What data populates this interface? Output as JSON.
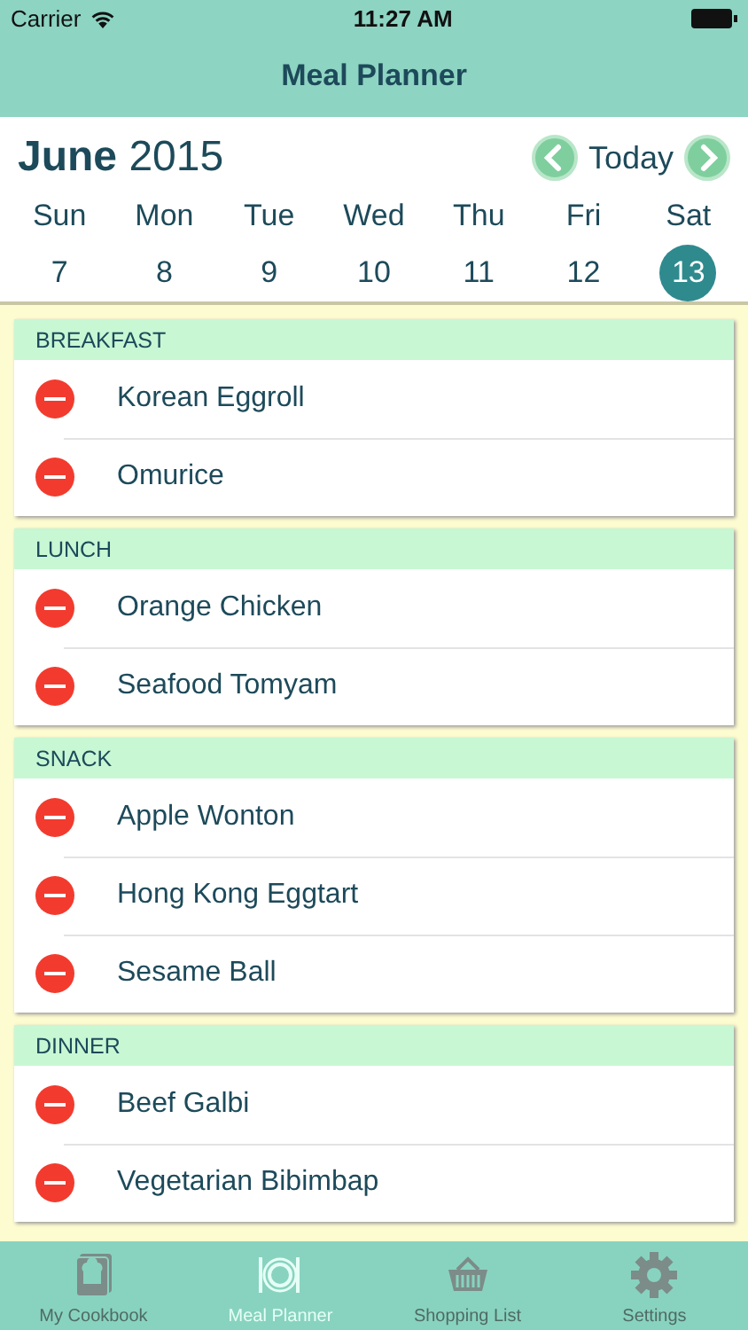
{
  "status_bar": {
    "carrier": "Carrier",
    "time": "11:27 AM"
  },
  "nav": {
    "title": "Meal Planner"
  },
  "calendar": {
    "month": "June",
    "year": "2015",
    "today_label": "Today",
    "days": [
      {
        "weekday": "Sun",
        "date": "7",
        "selected": false
      },
      {
        "weekday": "Mon",
        "date": "8",
        "selected": false
      },
      {
        "weekday": "Tue",
        "date": "9",
        "selected": false
      },
      {
        "weekday": "Wed",
        "date": "10",
        "selected": false
      },
      {
        "weekday": "Thu",
        "date": "11",
        "selected": false
      },
      {
        "weekday": "Fri",
        "date": "12",
        "selected": false
      },
      {
        "weekday": "Sat",
        "date": "13",
        "selected": true
      }
    ]
  },
  "sections": [
    {
      "title": "BREAKFAST",
      "items": [
        "Korean Eggroll",
        "Omurice"
      ]
    },
    {
      "title": "LUNCH",
      "items": [
        "Orange Chicken",
        "Seafood Tomyam"
      ]
    },
    {
      "title": "SNACK",
      "items": [
        "Apple Wonton",
        "Hong Kong Eggtart",
        "Sesame Ball"
      ]
    },
    {
      "title": "DINNER",
      "items": [
        "Beef Galbi",
        "Vegetarian Bibimbap"
      ]
    }
  ],
  "tab_bar": [
    {
      "label": "My Cookbook",
      "kind": "cookbook",
      "selected": false
    },
    {
      "label": "Meal Planner",
      "kind": "plate",
      "selected": true
    },
    {
      "label": "Shopping List",
      "kind": "basket",
      "selected": false
    },
    {
      "label": "Settings",
      "kind": "gear",
      "selected": false
    }
  ]
}
